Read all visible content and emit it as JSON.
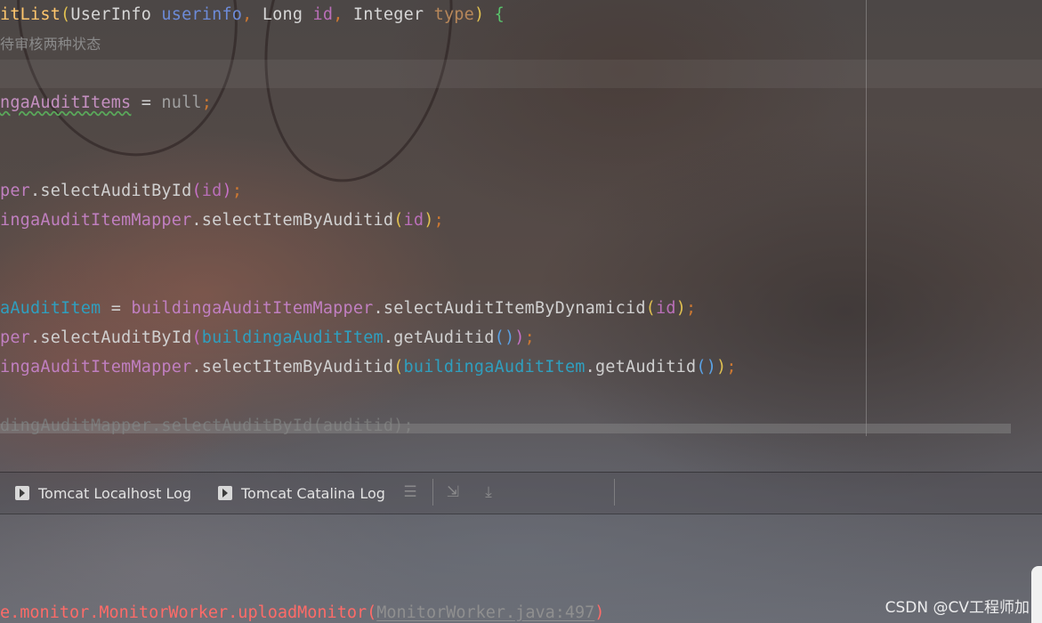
{
  "editor": {
    "line1": {
      "method": "itList",
      "open": "(",
      "t1": "UserInfo ",
      "p1": "userinfo",
      "c1": ", ",
      "t2": "Long ",
      "p2": "id",
      "c2": ", ",
      "t3": "Integer ",
      "p3": "type",
      "close": ") ",
      "brace": "{"
    },
    "line2_comment": "待审核两种状态",
    "line3": {
      "name": "ngaAuditItems",
      "eq": " = ",
      "value": "null",
      "semi": ";"
    },
    "line4": {
      "obj": "per",
      "dot": ".",
      "method": "selectAuditById",
      "open": "(",
      "arg": "id",
      "close": ")",
      "semi": ";"
    },
    "line5": {
      "obj": "ingaAuditItemMapper",
      "dot": ".",
      "method": "selectItemByAuditid",
      "open": "(",
      "arg": "id",
      "close": ")",
      "semi": ";"
    },
    "line6": {
      "name": "aAuditItem",
      "eq": " = ",
      "obj": "buildingaAuditItemMapper",
      "dot": ".",
      "method": "selectAuditItemByDynamicid",
      "open": "(",
      "arg": "id",
      "close": ")",
      "semi": ";"
    },
    "line7": {
      "obj": "per",
      "dot": ".",
      "method": "selectAuditById",
      "open": "(",
      "local": "buildingaAuditItem",
      "dot2": ".",
      "getter": "getAuditid",
      "parens": "()",
      "close": ")",
      "semi": ";"
    },
    "line8": {
      "obj": "ingaAuditItemMapper",
      "dot": ".",
      "method": "selectItemByAuditid",
      "open": "(",
      "local": "buildingaAuditItem",
      "dot2": ".",
      "getter": "getAuditid",
      "parens": "()",
      "close": ")",
      "semi": ";"
    },
    "line9_dim": "dingAuditMapper.selectAuditById(auditid);"
  },
  "tool_tabs": [
    {
      "label": "Tomcat Localhost Log",
      "icon": "console-icon"
    },
    {
      "label": "Tomcat Catalina Log",
      "icon": "console-icon"
    }
  ],
  "toolbar_icons": [
    "soft-wrap-icon",
    "scroll-to-end-icon",
    "download-icon"
  ],
  "console": {
    "stack_frame": "e.monitor.MonitorWorker.uploadMonitor",
    "open": "(",
    "location": "MonitorWorker.java:497",
    "close": ")"
  },
  "watermark": "CSDN @CV工程师加"
}
